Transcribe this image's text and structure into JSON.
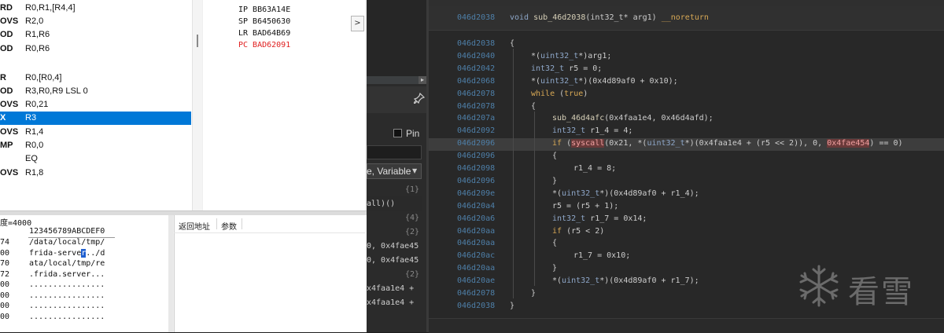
{
  "disasm": {
    "rows": [
      {
        "mn": "RD",
        "op": "R0,R1,[R4,4]"
      },
      {
        "mn": "OVS",
        "op": "R2,0"
      },
      {
        "mn": "OD",
        "op": "R1,R6"
      },
      {
        "mn": "OD",
        "op": "R0,R6"
      },
      {
        "mn": "",
        "op": ""
      },
      {
        "mn": "R",
        "op": "R0,[R0,4]"
      },
      {
        "mn": "OD",
        "op": "R3,R0,R9 LSL 0"
      },
      {
        "mn": "OVS",
        "op": "R0,21"
      },
      {
        "mn": "X",
        "op": "R3",
        "selected": true
      },
      {
        "mn": "OVS",
        "op": "R1,4"
      },
      {
        "mn": "MP",
        "op": "R0,0"
      },
      {
        "mn": "",
        "op": "EQ"
      },
      {
        "mn": "OVS",
        "op": "R1,8"
      }
    ]
  },
  "registers": [
    {
      "name": "IP",
      "value": "BB63A14E"
    },
    {
      "name": "SP",
      "value": "B6450630"
    },
    {
      "name": "LR",
      "value": "BAD64B69"
    },
    {
      "name": "PC",
      "value": "BAD62091",
      "highlight": true
    }
  ],
  "register_expand_button": ">",
  "memory": {
    "header": "度=4000",
    "ruler": "123456789ABCDEF0",
    "rows": [
      {
        "addr": "74",
        "text": "/data/local/tmp/"
      },
      {
        "addr": "00",
        "text_before": "frida-serve",
        "cursor": "r",
        "text_after": "../d"
      },
      {
        "addr": "70",
        "text": "ata/local/tmp/re"
      },
      {
        "addr": "72",
        "text": ".frida.server..."
      },
      {
        "addr": "00",
        "text": "................"
      },
      {
        "addr": "00",
        "text": "................"
      },
      {
        "addr": "00",
        "text": "................"
      },
      {
        "addr": "00",
        "text": "................"
      }
    ]
  },
  "stack": {
    "col_return": "返回地址",
    "col_params": "参数"
  },
  "mid": {
    "pin_label": "Pin",
    "select_label": "e, Variable",
    "lines": [
      {
        "text": "",
        "num": "{1}"
      },
      {
        "text": "all)()",
        "num": ""
      },
      {
        "text": "",
        "num": "{4}"
      },
      {
        "text": "",
        "num": "{2}"
      },
      {
        "text": "0, 0x4fae45",
        "num": ""
      },
      {
        "text": "0, 0x4fae45",
        "num": ""
      },
      {
        "text": "",
        "num": "{2}"
      },
      {
        "text": "x4faa1e4 +",
        "num": ""
      },
      {
        "text": "x4faa1e4 +",
        "num": ""
      }
    ]
  },
  "code": {
    "header_addr": "046d2038",
    "header_sig": {
      "ret": "void",
      "name": "sub_46d2038",
      "args": "(int32_t* arg1)",
      "attr": "__noreturn"
    },
    "lines": [
      {
        "addr": "046d2038",
        "indent": 0,
        "text": "{"
      },
      {
        "addr": "046d2040",
        "indent": 1,
        "text": "*(uint32_t*)arg1;"
      },
      {
        "addr": "046d2042",
        "indent": 1,
        "text": "int32_t r5 = 0;"
      },
      {
        "addr": "046d2068",
        "indent": 1,
        "text": "*(uint32_t*)(0x4d89af0 + 0x10);"
      },
      {
        "addr": "046d2078",
        "indent": 1,
        "text": "while (true)"
      },
      {
        "addr": "046d2078",
        "indent": 1,
        "text": "{"
      },
      {
        "addr": "046d207a",
        "indent": 2,
        "text": "sub_46d4afc(0x4faa1e4, 0x46d4afd);"
      },
      {
        "addr": "046d2092",
        "indent": 2,
        "text": "int32_t r1_4 = 4;"
      },
      {
        "addr": "046d2096",
        "indent": 2,
        "pre": "if (",
        "box1": "syscall",
        "mid": "(0x21, *(uint32_t*)(0x4faa1e4 + (r5 << 2)), 0, ",
        "box2": "0x4fae454",
        "post": ") == 0)",
        "current": true
      },
      {
        "addr": "046d2096",
        "indent": 2,
        "text": "{"
      },
      {
        "addr": "046d2098",
        "indent": 3,
        "text": "r1_4 = 8;"
      },
      {
        "addr": "046d2096",
        "indent": 2,
        "text": "}"
      },
      {
        "addr": "046d209e",
        "indent": 2,
        "text": "*(uint32_t*)(0x4d89af0 + r1_4);"
      },
      {
        "addr": "046d20a4",
        "indent": 2,
        "text": "r5 = (r5 + 1);"
      },
      {
        "addr": "046d20a6",
        "indent": 2,
        "text": "int32_t r1_7 = 0x14;"
      },
      {
        "addr": "046d20aa",
        "indent": 2,
        "text": "if (r5 < 2)"
      },
      {
        "addr": "046d20aa",
        "indent": 2,
        "text": "{"
      },
      {
        "addr": "046d20ac",
        "indent": 3,
        "text": "r1_7 = 0x10;"
      },
      {
        "addr": "046d20aa",
        "indent": 2,
        "text": "}"
      },
      {
        "addr": "046d20ae",
        "indent": 2,
        "text": "*(uint32_t*)(0x4d89af0 + r1_7);"
      },
      {
        "addr": "046d2078",
        "indent": 1,
        "text": "}"
      },
      {
        "addr": "046d2038",
        "indent": 0,
        "text": "}"
      }
    ]
  },
  "watermark": {
    "text": "看雪",
    "icon": "snowflake-logo-icon"
  },
  "colors": {
    "selection": "#0078d7",
    "pc_register": "#e02020",
    "code_address": "#4e7fa8",
    "keyword": "#d7a855",
    "syscall_highlight": "#6a3a3a"
  }
}
